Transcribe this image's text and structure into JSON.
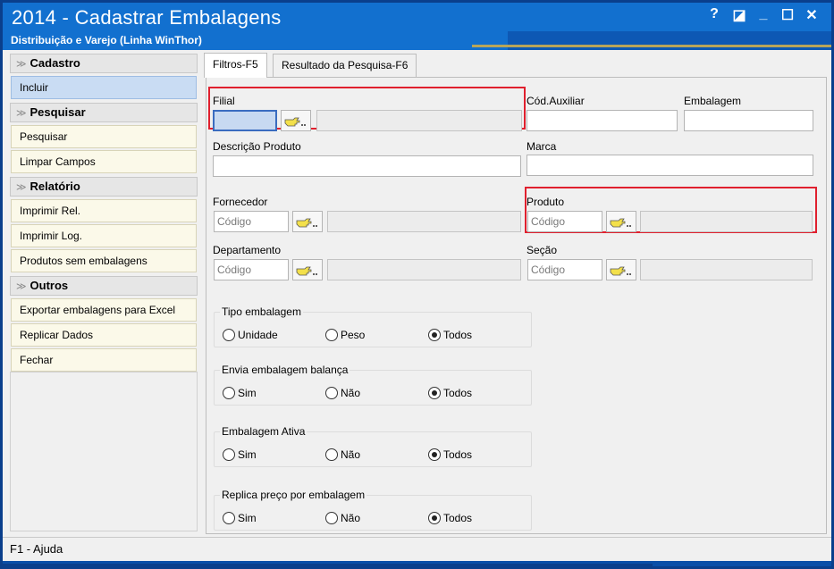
{
  "window": {
    "title": "2014 - Cadastrar Embalagens",
    "subtitle": "Distribuição e Varejo (Linha WinThor)",
    "btn_help": "?",
    "btn_restore": "◪",
    "btn_min": "_",
    "btn_max": "☐",
    "btn_close": "✕"
  },
  "sidebar": {
    "sections": [
      {
        "title": "Cadastro",
        "items": [
          "Incluir"
        ]
      },
      {
        "title": "Pesquisar",
        "items": [
          "Pesquisar",
          "Limpar Campos"
        ]
      },
      {
        "title": "Relatório",
        "items": [
          "Imprimir Rel.",
          "Imprimir Log.",
          "Produtos sem embalagens"
        ]
      },
      {
        "title": "Outros",
        "items": [
          "Exportar embalagens para Excel",
          "Replicar Dados",
          "Fechar"
        ]
      }
    ]
  },
  "tabs": [
    "Filtros-F5",
    "Resultado da Pesquisa-F6"
  ],
  "form": {
    "filial_label": "Filial",
    "cod_auxiliar_label": "Cód.Auxiliar",
    "embalagem_label": "Embalagem",
    "descricao_label": "Descrição Produto",
    "marca_label": "Marca",
    "fornecedor_label": "Fornecedor",
    "produto_label": "Produto",
    "departamento_label": "Departamento",
    "secao_label": "Seção",
    "codigo_placeholder": "Código"
  },
  "groups": {
    "tipo": {
      "title": "Tipo embalagem",
      "options": [
        "Unidade",
        "Peso",
        "Todos"
      ],
      "selected": "Todos"
    },
    "balanca": {
      "title": "Envia embalagem balança",
      "options": [
        "Sim",
        "Não",
        "Todos"
      ],
      "selected": "Todos"
    },
    "ativa": {
      "title": "Embalagem Ativa",
      "options": [
        "Sim",
        "Não",
        "Todos"
      ],
      "selected": "Todos"
    },
    "replica": {
      "title": "Replica preço por embalagem",
      "options": [
        "Sim",
        "Não",
        "Todos"
      ],
      "selected": "Todos"
    }
  },
  "status": {
    "text": "F1 - Ajuda"
  },
  "colors": {
    "titlebar": "#1270cf",
    "highlight": "#e0202e",
    "menu_item": "#fbf9e9",
    "active_item": "#c9dcf3"
  }
}
